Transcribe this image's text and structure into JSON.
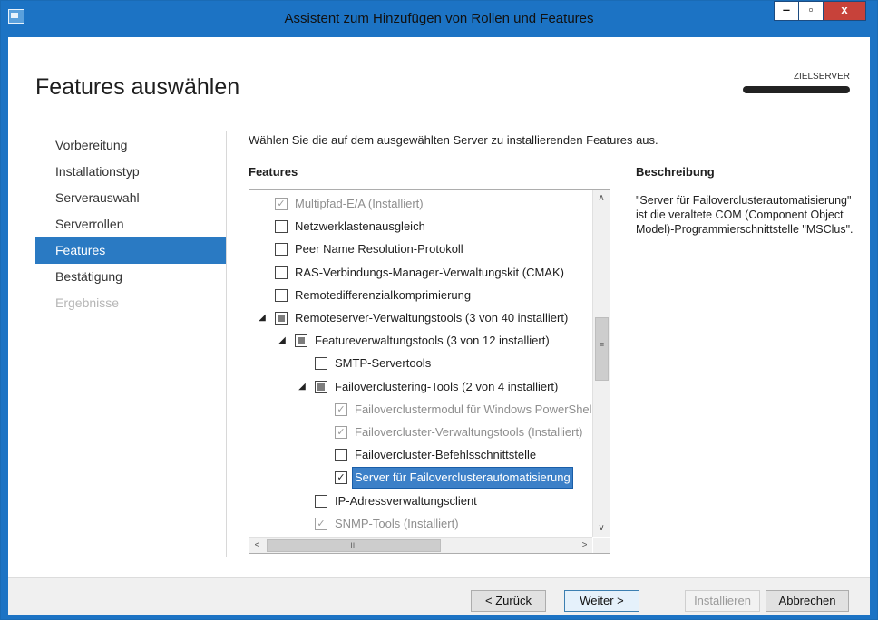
{
  "window": {
    "title": "Assistent zum Hinzufügen von Rollen und Features",
    "min_label": "‒",
    "max_label": "▫",
    "close_label": "x"
  },
  "page": {
    "heading": "Features auswählen",
    "target_server_label": "ZIELSERVER",
    "instruction": "Wählen Sie die auf dem ausgewählten Server zu installierenden Features aus."
  },
  "nav": {
    "items": [
      {
        "label": "Vorbereitung",
        "state": "normal"
      },
      {
        "label": "Installationstyp",
        "state": "normal"
      },
      {
        "label": "Serverauswahl",
        "state": "normal"
      },
      {
        "label": "Serverrollen",
        "state": "normal"
      },
      {
        "label": "Features",
        "state": "active"
      },
      {
        "label": "Bestätigung",
        "state": "normal"
      },
      {
        "label": "Ergebnisse",
        "state": "disabled"
      }
    ]
  },
  "features": {
    "label": "Features",
    "rows": [
      {
        "label": "Multipfad-E/A (Installiert)",
        "check": "checked",
        "disabled": true,
        "level": 0,
        "toggle": ""
      },
      {
        "label": "Netzwerklastenausgleich",
        "check": "unchecked",
        "disabled": false,
        "level": 0,
        "toggle": ""
      },
      {
        "label": "Peer Name Resolution-Protokoll",
        "check": "unchecked",
        "disabled": false,
        "level": 0,
        "toggle": ""
      },
      {
        "label": "RAS-Verbindungs-Manager-Verwaltungskit (CMAK)",
        "check": "unchecked",
        "disabled": false,
        "level": 0,
        "toggle": ""
      },
      {
        "label": "Remotedifferenzialkomprimierung",
        "check": "unchecked",
        "disabled": false,
        "level": 0,
        "toggle": ""
      },
      {
        "label": "Remoteserver-Verwaltungstools (3 von 40 installiert)",
        "check": "partial",
        "disabled": false,
        "level": 0,
        "toggle": "◢"
      },
      {
        "label": "Featureverwaltungstools (3 von 12 installiert)",
        "check": "partial",
        "disabled": false,
        "level": 1,
        "toggle": "◢"
      },
      {
        "label": "SMTP-Servertools",
        "check": "unchecked",
        "disabled": false,
        "level": 2,
        "toggle": ""
      },
      {
        "label": "Failoverclustering-Tools (2 von 4 installiert)",
        "check": "partial",
        "disabled": false,
        "level": 2,
        "toggle": "◢"
      },
      {
        "label": "Failoverclustermodul für Windows PowerShell",
        "check": "checked",
        "disabled": true,
        "level": 3,
        "toggle": ""
      },
      {
        "label": "Failovercluster-Verwaltungstools (Installiert)",
        "check": "checked",
        "disabled": true,
        "level": 3,
        "toggle": ""
      },
      {
        "label": "Failovercluster-Befehlsschnittstelle",
        "check": "unchecked",
        "disabled": false,
        "level": 3,
        "toggle": ""
      },
      {
        "label": "Server für Failoverclusterautomatisierung",
        "check": "checked",
        "disabled": false,
        "level": 3,
        "toggle": "",
        "selected": true
      },
      {
        "label": "IP-Adressverwaltungsclient",
        "check": "unchecked",
        "disabled": false,
        "level": 2,
        "toggle": ""
      },
      {
        "label": "SNMP-Tools (Installiert)",
        "check": "checked",
        "disabled": true,
        "level": 2,
        "toggle": ""
      }
    ]
  },
  "scroll": {
    "up": "∧",
    "down": "∨",
    "left": "<",
    "right": ">",
    "grip_v": "≡",
    "grip_h": "III"
  },
  "description": {
    "label": "Beschreibung",
    "text": "\"Server für Failoverclusterautomatisierung\" ist die veraltete COM (Component Object Model)-Programmierschnittstelle \"MSClus\"."
  },
  "buttons": {
    "back": "< Zurück",
    "next": "Weiter >",
    "install": "Installieren",
    "cancel": "Abbrechen"
  }
}
